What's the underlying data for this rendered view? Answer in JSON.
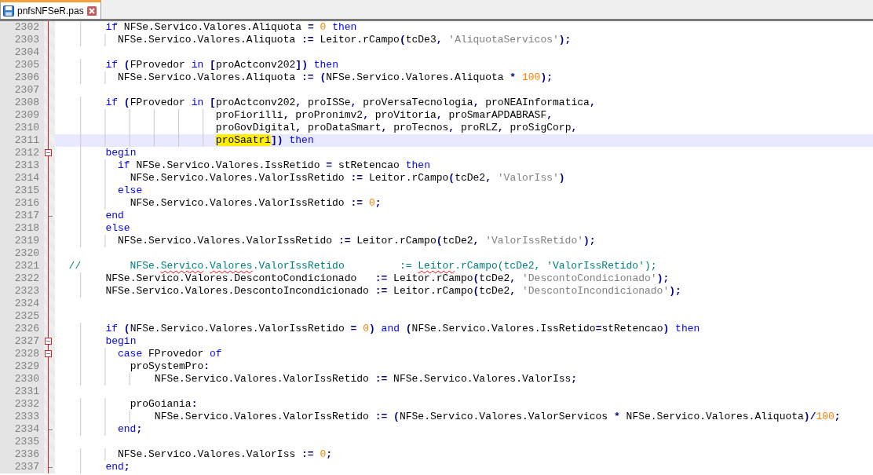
{
  "tab": {
    "filename": "pnfsNFSeR.pas",
    "selected": true
  },
  "lines": [
    {
      "number": "2302",
      "fold_start": false,
      "fold_end": false,
      "current": false,
      "segments": [
        {
          "text": "        if",
          "kind": "kw"
        },
        {
          "text": " NFSe.Servico.Valores.Aliquota ",
          "kind": "id"
        },
        {
          "text": "=",
          "kind": "op"
        },
        {
          "text": " 0",
          "kind": "num"
        },
        {
          "text": " then",
          "kind": "kw"
        }
      ]
    },
    {
      "number": "2303",
      "fold_start": false,
      "fold_end": false,
      "current": false,
      "segments": [
        {
          "text": "          NFSe.Servico.Valores.Aliquota ",
          "kind": "id"
        },
        {
          "text": ":=",
          "kind": "op"
        },
        {
          "text": " Leitor.rCampo",
          "kind": "id"
        },
        {
          "text": "(",
          "kind": "op"
        },
        {
          "text": "tcDe3",
          "kind": "id"
        },
        {
          "text": ",",
          "kind": "op"
        },
        {
          "text": " 'AliquotaServicos'",
          "kind": "str"
        },
        {
          "text": ");",
          "kind": "op"
        }
      ]
    },
    {
      "number": "2304",
      "fold_start": false,
      "fold_end": false,
      "current": false
    },
    {
      "number": "2305",
      "fold_start": false,
      "fold_end": false,
      "current": false,
      "segments": [
        {
          "text": "        if",
          "kind": "kw"
        },
        {
          "text": " (",
          "kind": "op"
        },
        {
          "text": "FProvedor ",
          "kind": "id"
        },
        {
          "text": "in",
          "kind": "kw"
        },
        {
          "text": " [",
          "kind": "op"
        },
        {
          "text": "proActconv202",
          "kind": "id"
        },
        {
          "text": "])",
          "kind": "op"
        },
        {
          "text": " then",
          "kind": "kw"
        }
      ]
    },
    {
      "number": "2306",
      "fold_start": false,
      "fold_end": false,
      "current": false,
      "segments": [
        {
          "text": "          NFSe.Servico.Valores.Aliquota ",
          "kind": "id"
        },
        {
          "text": ":=",
          "kind": "op"
        },
        {
          "text": " (",
          "kind": "op"
        },
        {
          "text": "NFSe.Servico.Valores.Aliquota ",
          "kind": "id"
        },
        {
          "text": "*",
          "kind": "op"
        },
        {
          "text": " 100",
          "kind": "num"
        },
        {
          "text": ");",
          "kind": "op"
        }
      ]
    },
    {
      "number": "2307",
      "fold_start": false,
      "fold_end": false,
      "current": false
    },
    {
      "number": "2308",
      "fold_start": false,
      "fold_end": false,
      "current": false,
      "segments": [
        {
          "text": "        if",
          "kind": "kw"
        },
        {
          "text": " (",
          "kind": "op"
        },
        {
          "text": "FProvedor ",
          "kind": "id"
        },
        {
          "text": "in",
          "kind": "kw"
        },
        {
          "text": " [",
          "kind": "op"
        },
        {
          "text": "proActconv202",
          "kind": "id"
        },
        {
          "text": ",",
          "kind": "op"
        },
        {
          "text": " proISSe",
          "kind": "id"
        },
        {
          "text": ",",
          "kind": "op"
        },
        {
          "text": " proVersaTecnologia",
          "kind": "id"
        },
        {
          "text": ",",
          "kind": "op"
        },
        {
          "text": " proNEAInformatica",
          "kind": "id"
        },
        {
          "text": ",",
          "kind": "op"
        }
      ]
    },
    {
      "number": "2309",
      "fold_start": false,
      "fold_end": false,
      "current": false,
      "segments": [
        {
          "text": "                          proFiorilli",
          "kind": "id"
        },
        {
          "text": ",",
          "kind": "op"
        },
        {
          "text": " proPronimv2",
          "kind": "id"
        },
        {
          "text": ",",
          "kind": "op"
        },
        {
          "text": " proVitoria",
          "kind": "id"
        },
        {
          "text": ",",
          "kind": "op"
        },
        {
          "text": " proSmarAPDABRASF",
          "kind": "id"
        },
        {
          "text": ",",
          "kind": "op"
        }
      ]
    },
    {
      "number": "2310",
      "fold_start": false,
      "fold_end": false,
      "current": false,
      "segments": [
        {
          "text": "                          proGovDigital",
          "kind": "id"
        },
        {
          "text": ",",
          "kind": "op"
        },
        {
          "text": " proDataSmart",
          "kind": "id"
        },
        {
          "text": ",",
          "kind": "op"
        },
        {
          "text": " proTecnos",
          "kind": "id"
        },
        {
          "text": ",",
          "kind": "op"
        },
        {
          "text": " proRLZ",
          "kind": "id"
        },
        {
          "text": ",",
          "kind": "op"
        },
        {
          "text": " proSigCorp",
          "kind": "id"
        },
        {
          "text": ",",
          "kind": "op"
        }
      ]
    },
    {
      "number": "2311",
      "fold_start": false,
      "fold_end": false,
      "current": true,
      "segments": [
        {
          "text": "                          proSaatri",
          "kind": "marked"
        },
        {
          "text": "])",
          "kind": "op"
        },
        {
          "text": " then",
          "kind": "kw"
        }
      ]
    },
    {
      "number": "2312",
      "fold_start": true,
      "fold_end": false,
      "current": false,
      "segments": [
        {
          "text": "        begin",
          "kind": "kw"
        }
      ]
    },
    {
      "number": "2313",
      "fold_start": false,
      "fold_end": false,
      "current": false,
      "segments": [
        {
          "text": "          if",
          "kind": "kw"
        },
        {
          "text": " NFSe.Servico.Valores.IssRetido ",
          "kind": "id"
        },
        {
          "text": "=",
          "kind": "op"
        },
        {
          "text": " stRetencao ",
          "kind": "id"
        },
        {
          "text": "then",
          "kind": "kw"
        }
      ]
    },
    {
      "number": "2314",
      "fold_start": false,
      "fold_end": false,
      "current": false,
      "segments": [
        {
          "text": "            NFSe.Servico.Valores.ValorIssRetido ",
          "kind": "id"
        },
        {
          "text": ":=",
          "kind": "op"
        },
        {
          "text": " Leitor.rCampo",
          "kind": "id"
        },
        {
          "text": "(",
          "kind": "op"
        },
        {
          "text": "tcDe2",
          "kind": "id"
        },
        {
          "text": ",",
          "kind": "op"
        },
        {
          "text": " 'ValorIss'",
          "kind": "str"
        },
        {
          "text": ")",
          "kind": "op"
        }
      ]
    },
    {
      "number": "2315",
      "fold_start": false,
      "fold_end": false,
      "current": false,
      "segments": [
        {
          "text": "          else",
          "kind": "kw"
        }
      ]
    },
    {
      "number": "2316",
      "fold_start": false,
      "fold_end": false,
      "current": false,
      "segments": [
        {
          "text": "            NFSe.Servico.Valores.ValorIssRetido ",
          "kind": "id"
        },
        {
          "text": ":=",
          "kind": "op"
        },
        {
          "text": " 0",
          "kind": "num"
        },
        {
          "text": ";",
          "kind": "op"
        }
      ]
    },
    {
      "number": "2317",
      "fold_start": false,
      "fold_end": true,
      "current": false,
      "segments": [
        {
          "text": "        end",
          "kind": "kw"
        }
      ]
    },
    {
      "number": "2318",
      "fold_start": false,
      "fold_end": false,
      "current": false,
      "segments": [
        {
          "text": "        else",
          "kind": "kw"
        }
      ]
    },
    {
      "number": "2319",
      "fold_start": false,
      "fold_end": false,
      "current": false,
      "segments": [
        {
          "text": "          NFSe.Servico.Valores.ValorIssRetido ",
          "kind": "id"
        },
        {
          "text": ":=",
          "kind": "op"
        },
        {
          "text": " Leitor.rCampo",
          "kind": "id"
        },
        {
          "text": "(",
          "kind": "op"
        },
        {
          "text": "tcDe2",
          "kind": "id"
        },
        {
          "text": ",",
          "kind": "op"
        },
        {
          "text": " 'ValorIssRetido'",
          "kind": "str"
        },
        {
          "text": ");",
          "kind": "op"
        }
      ]
    },
    {
      "number": "2320",
      "fold_start": false,
      "fold_end": false,
      "current": false
    },
    {
      "number": "2321",
      "fold_start": false,
      "fold_end": false,
      "current": false,
      "segments": [
        {
          "text": "  //        NFSe.",
          "kind": "cm"
        },
        {
          "text": "Servico",
          "kind": "cm-misspelled"
        },
        {
          "text": ".",
          "kind": "cm"
        },
        {
          "text": "Valores",
          "kind": "cm-misspelled"
        },
        {
          "text": ".ValorIssRetido         := ",
          "kind": "cm"
        },
        {
          "text": "Leitor",
          "kind": "cm-misspelled"
        },
        {
          "text": ".rCampo(tcDe2, 'ValorIssRetido');",
          "kind": "cm"
        }
      ]
    },
    {
      "number": "2322",
      "fold_start": false,
      "fold_end": false,
      "current": false,
      "segments": [
        {
          "text": "        NFSe.Servico.Valores.DescontoCondicionado   ",
          "kind": "id"
        },
        {
          "text": ":=",
          "kind": "op"
        },
        {
          "text": " Leitor.rCampo",
          "kind": "id"
        },
        {
          "text": "(",
          "kind": "op"
        },
        {
          "text": "tcDe2",
          "kind": "id"
        },
        {
          "text": ",",
          "kind": "op"
        },
        {
          "text": " 'DescontoCondicionado'",
          "kind": "str"
        },
        {
          "text": ");",
          "kind": "op"
        }
      ]
    },
    {
      "number": "2323",
      "fold_start": false,
      "fold_end": false,
      "current": false,
      "segments": [
        {
          "text": "        NFSe.Servico.Valores.DescontoIncondicionado ",
          "kind": "id"
        },
        {
          "text": ":=",
          "kind": "op"
        },
        {
          "text": " Leitor.rCampo",
          "kind": "id"
        },
        {
          "text": "(",
          "kind": "op"
        },
        {
          "text": "tcDe2",
          "kind": "id"
        },
        {
          "text": ",",
          "kind": "op"
        },
        {
          "text": " 'DescontoIncondicionado'",
          "kind": "str"
        },
        {
          "text": ");",
          "kind": "op"
        }
      ]
    },
    {
      "number": "2324",
      "fold_start": false,
      "fold_end": false,
      "current": false
    },
    {
      "number": "2325",
      "fold_start": false,
      "fold_end": false,
      "current": false
    },
    {
      "number": "2326",
      "fold_start": false,
      "fold_end": false,
      "current": false,
      "segments": [
        {
          "text": "        if",
          "kind": "kw"
        },
        {
          "text": " (",
          "kind": "op"
        },
        {
          "text": "NFSe.Servico.Valores.ValorIssRetido ",
          "kind": "id"
        },
        {
          "text": "=",
          "kind": "op"
        },
        {
          "text": " 0",
          "kind": "num"
        },
        {
          "text": ")",
          "kind": "op"
        },
        {
          "text": " and",
          "kind": "kw"
        },
        {
          "text": " (",
          "kind": "op"
        },
        {
          "text": "NFSe.Servico.Valores.IssRetido",
          "kind": "id"
        },
        {
          "text": "=",
          "kind": "op"
        },
        {
          "text": "stRetencao",
          "kind": "id"
        },
        {
          "text": ")",
          "kind": "op"
        },
        {
          "text": " then",
          "kind": "kw"
        }
      ]
    },
    {
      "number": "2327",
      "fold_start": true,
      "fold_end": false,
      "current": false,
      "segments": [
        {
          "text": "        begin",
          "kind": "kw"
        }
      ]
    },
    {
      "number": "2328",
      "fold_start": true,
      "fold_end": false,
      "current": false,
      "segments": [
        {
          "text": "          case",
          "kind": "kw"
        },
        {
          "text": " FProvedor ",
          "kind": "id"
        },
        {
          "text": "of",
          "kind": "kw"
        }
      ]
    },
    {
      "number": "2329",
      "fold_start": false,
      "fold_end": false,
      "current": false,
      "segments": [
        {
          "text": "            proSystemPro",
          "kind": "id"
        },
        {
          "text": ":",
          "kind": "op"
        }
      ]
    },
    {
      "number": "2330",
      "fold_start": false,
      "fold_end": false,
      "current": false,
      "segments": [
        {
          "text": "                NFSe.Servico.Valores.ValorIssRetido ",
          "kind": "id"
        },
        {
          "text": ":=",
          "kind": "op"
        },
        {
          "text": " NFSe.Servico.Valores.ValorIss",
          "kind": "id"
        },
        {
          "text": ";",
          "kind": "op"
        }
      ]
    },
    {
      "number": "2331",
      "fold_start": false,
      "fold_end": false,
      "current": false
    },
    {
      "number": "2332",
      "fold_start": false,
      "fold_end": false,
      "current": false,
      "segments": [
        {
          "text": "            proGoiania",
          "kind": "id"
        },
        {
          "text": ":",
          "kind": "op"
        }
      ]
    },
    {
      "number": "2333",
      "fold_start": false,
      "fold_end": false,
      "current": false,
      "segments": [
        {
          "text": "                NFSe.Servico.Valores.ValorIssRetido ",
          "kind": "id"
        },
        {
          "text": ":=",
          "kind": "op"
        },
        {
          "text": " (",
          "kind": "op"
        },
        {
          "text": "NFSe.Servico.Valores.ValorServicos ",
          "kind": "id"
        },
        {
          "text": "*",
          "kind": "op"
        },
        {
          "text": " NFSe.Servico.Valores.Aliquota",
          "kind": "id"
        },
        {
          "text": ")/",
          "kind": "op"
        },
        {
          "text": "100",
          "kind": "num"
        },
        {
          "text": ";",
          "kind": "op"
        }
      ]
    },
    {
      "number": "2334",
      "fold_start": false,
      "fold_end": true,
      "current": false,
      "segments": [
        {
          "text": "          end",
          "kind": "kw"
        },
        {
          "text": ";",
          "kind": "op"
        }
      ]
    },
    {
      "number": "2335",
      "fold_start": false,
      "fold_end": false,
      "current": false
    },
    {
      "number": "2336",
      "fold_start": false,
      "fold_end": false,
      "current": false,
      "segments": [
        {
          "text": "          NFSe.Servico.Valores.ValorIss ",
          "kind": "id"
        },
        {
          "text": ":=",
          "kind": "op"
        },
        {
          "text": " 0",
          "kind": "num"
        },
        {
          "text": ";",
          "kind": "op"
        }
      ]
    },
    {
      "number": "2337",
      "fold_start": false,
      "fold_end": true,
      "current": false,
      "segments": [
        {
          "text": "        end",
          "kind": "kw"
        },
        {
          "text": ";",
          "kind": "op"
        }
      ]
    }
  ]
}
